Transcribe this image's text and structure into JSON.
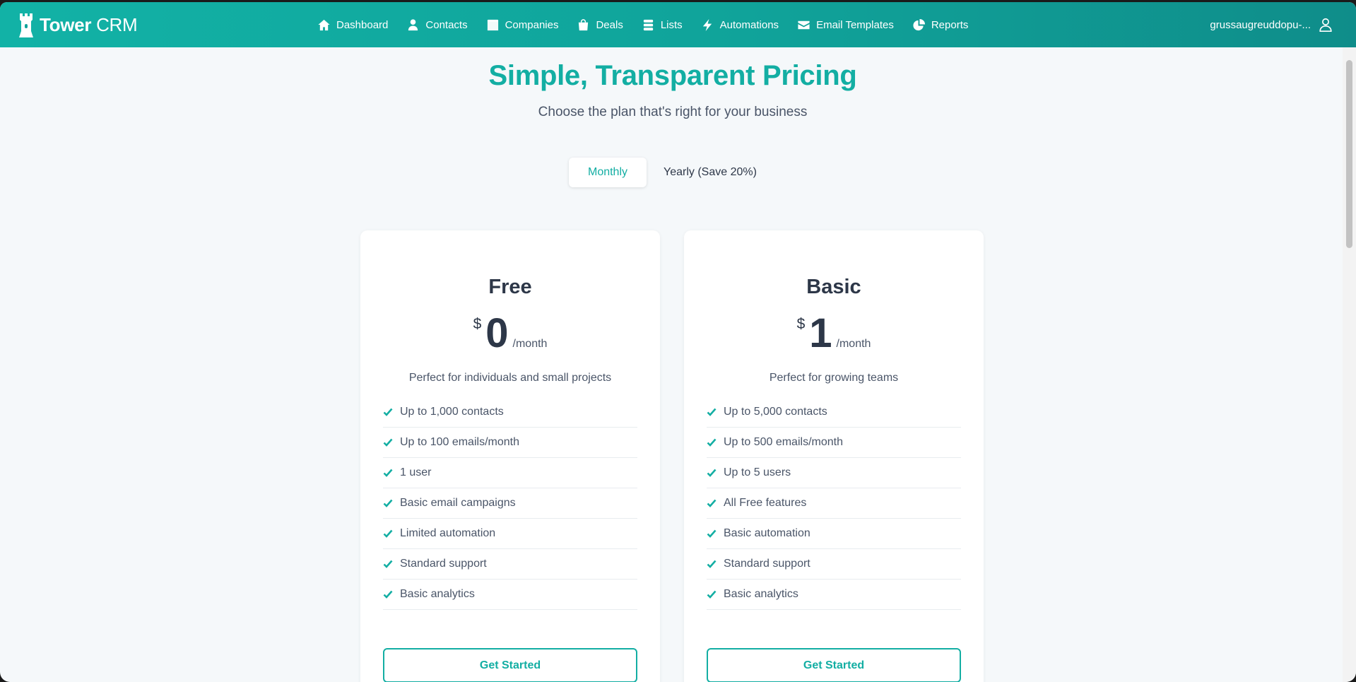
{
  "app": {
    "brand_prefix": "Tower",
    "brand_suffix": "CRM"
  },
  "nav": {
    "items": [
      {
        "label": "Dashboard",
        "icon": "home-icon"
      },
      {
        "label": "Contacts",
        "icon": "person-icon"
      },
      {
        "label": "Companies",
        "icon": "building-icon"
      },
      {
        "label": "Deals",
        "icon": "shopping-bag-icon"
      },
      {
        "label": "Lists",
        "icon": "list-icon"
      },
      {
        "label": "Automations",
        "icon": "bolt-icon"
      },
      {
        "label": "Email Templates",
        "icon": "envelope-icon"
      },
      {
        "label": "Reports",
        "icon": "pie-chart-icon"
      }
    ],
    "user_name": "grussaugreuddopu-..."
  },
  "pricing": {
    "title": "Simple, Transparent Pricing",
    "subtitle": "Choose the plan that's right for your business",
    "billing_toggle": {
      "monthly": "Monthly",
      "yearly": "Yearly (Save 20%)",
      "selected": "Monthly"
    },
    "plans": [
      {
        "name": "Free",
        "currency": "$",
        "amount": "0",
        "period": "/month",
        "description": "Perfect for individuals and small projects",
        "features": [
          "Up to 1,000 contacts",
          "Up to 100 emails/month",
          "1 user",
          "Basic email campaigns",
          "Limited automation",
          "Standard support",
          "Basic analytics"
        ],
        "cta": "Get Started"
      },
      {
        "name": "Basic",
        "currency": "$",
        "amount": "1",
        "period": "/month",
        "description": "Perfect for growing teams",
        "features": [
          "Up to 5,000 contacts",
          "Up to 500 emails/month",
          "Up to 5 users",
          "All Free features",
          "Basic automation",
          "Standard support",
          "Basic analytics"
        ],
        "cta": "Get Started"
      }
    ]
  },
  "colors": {
    "accent": "#13aea3",
    "navbar_start": "#12b2a6",
    "navbar_end": "#0f8d8a",
    "page_bg": "#f5f8fa",
    "text_dark": "#2d3748",
    "text_muted": "#4a5568"
  }
}
